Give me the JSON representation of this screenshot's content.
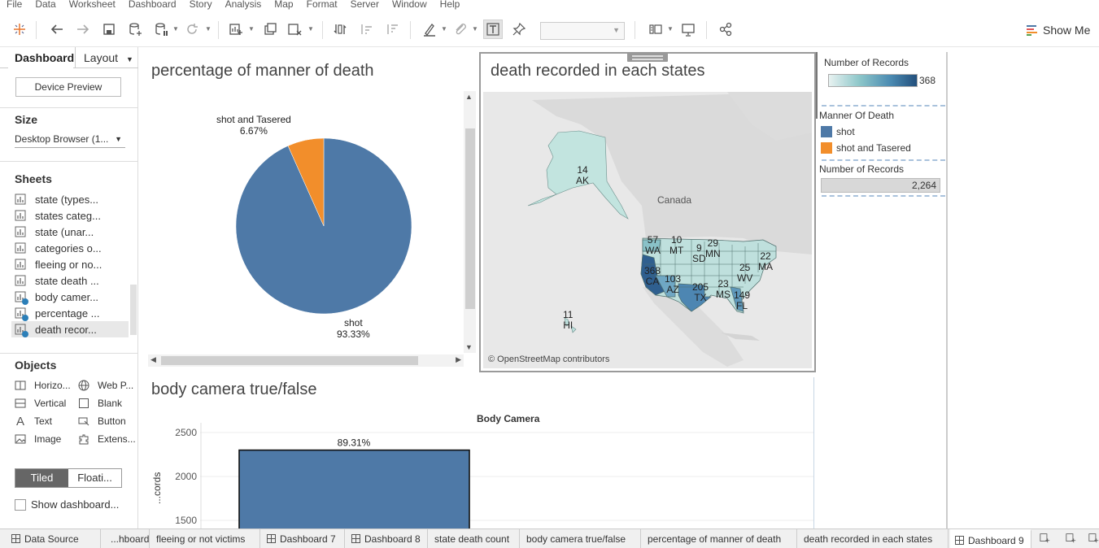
{
  "menu": [
    "File",
    "Data",
    "Worksheet",
    "Dashboard",
    "Story",
    "Analysis",
    "Map",
    "Format",
    "Server",
    "Window",
    "Help"
  ],
  "toolbar": {
    "show_me": "Show Me"
  },
  "left_panel": {
    "tabs": {
      "dashboard": "Dashboard",
      "layout": "Layout"
    },
    "device_preview": "Device Preview",
    "size_title": "Size",
    "size_value": "Desktop Browser (1...",
    "sheets_title": "Sheets",
    "sheets": [
      "state (types...",
      "states categ...",
      "state (unar...",
      "categories o...",
      "fleeing or no...",
      "state death ...",
      "body camer...",
      "percentage ...",
      "death recor..."
    ],
    "objects_title": "Objects",
    "objects": {
      "horizontal": "Horizo...",
      "web_page": "Web P...",
      "vertical": "Vertical",
      "blank": "Blank",
      "text": "Text",
      "button": "Button",
      "image": "Image",
      "extension": "Extens..."
    },
    "tiled": "Tiled",
    "floating": "Floati...",
    "show_dashboard_title": "Show dashboard..."
  },
  "pie_zone": {
    "title": "percentage of manner of death",
    "slices": [
      {
        "label": "shot",
        "pct_label": "93.33%",
        "value": 93.33,
        "color": "#4e79a7"
      },
      {
        "label": "shot and Tasered",
        "pct_label": "6.67%",
        "value": 6.67,
        "color": "#f28e2b"
      }
    ]
  },
  "map_zone": {
    "title": "death recorded in each states",
    "country_label": "Canada",
    "attribution": "© OpenStreetMap contributors",
    "states": [
      {
        "count": "14",
        "abbr": "AK"
      },
      {
        "count": "57",
        "abbr": "WA"
      },
      {
        "count": "10",
        "abbr": "MT"
      },
      {
        "count": "9",
        "abbr": "SD"
      },
      {
        "count": "29",
        "abbr": "MN"
      },
      {
        "count": "368",
        "abbr": "CA"
      },
      {
        "count": "103",
        "abbr": "AZ"
      },
      {
        "count": "205",
        "abbr": "TX"
      },
      {
        "count": "23",
        "abbr": "MS"
      },
      {
        "count": "25",
        "abbr": "WV"
      },
      {
        "count": "22",
        "abbr": "MA"
      },
      {
        "count": "149",
        "abbr": "FL"
      },
      {
        "count": "11",
        "abbr": "HI"
      }
    ]
  },
  "legends": {
    "records_color": {
      "title": "Number of Records",
      "max": "368"
    },
    "manner": {
      "title": "Manner Of Death",
      "items": [
        {
          "label": "shot",
          "color": "#4e79a7"
        },
        {
          "label": "shot and Tasered",
          "color": "#f28e2b"
        }
      ]
    },
    "records_size": {
      "title": "Number of Records",
      "value": "2,264"
    }
  },
  "bar_zone": {
    "title": "body camera true/false"
  },
  "chart_data": [
    {
      "type": "pie",
      "title": "percentage of manner of death",
      "categories": [
        "shot",
        "shot and Tasered"
      ],
      "values": [
        93.33,
        6.67
      ],
      "labels": [
        "93.33%",
        "6.67%"
      ]
    },
    {
      "type": "bar",
      "title": "Body Camera",
      "ylabel": "...cords",
      "yticks": [
        "2500",
        "2000",
        "1500"
      ],
      "ylim": [
        1500,
        2500
      ],
      "values": [
        2300
      ],
      "labels": [
        "89.31%"
      ]
    }
  ],
  "bottom_tabs": [
    "Data Source",
    "...hboard 6",
    "fleeing or not victims",
    "Dashboard 7",
    "Dashboard 8",
    "state death count",
    "body camera true/false",
    "percentage of manner of death",
    "death recorded in each states",
    "Dashboard 9"
  ],
  "colors": {
    "shot": "#4e79a7",
    "tasered": "#f28e2b",
    "map_low": "#d5ebe8",
    "map_high": "#2b5b8c"
  }
}
